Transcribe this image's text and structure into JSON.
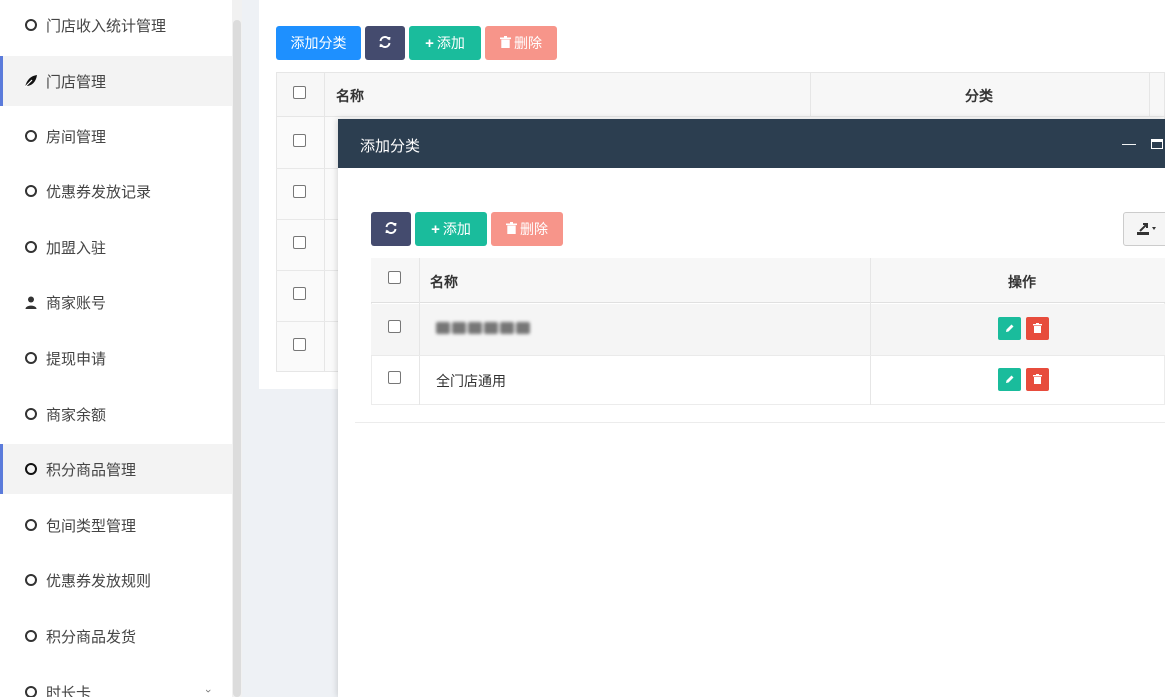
{
  "sidebar": {
    "items": [
      {
        "label": "门店收入统计管理",
        "icon": "circle-icon",
        "active": false
      },
      {
        "label": "门店管理",
        "icon": "leaf-icon",
        "active": true
      },
      {
        "label": "房间管理",
        "icon": "circle-icon",
        "active": false
      },
      {
        "label": "优惠券发放记录",
        "icon": "circle-icon",
        "active": false
      },
      {
        "label": "加盟入驻",
        "icon": "circle-icon",
        "active": false
      },
      {
        "label": "商家账号",
        "icon": "user-icon",
        "active": false
      },
      {
        "label": "提现申请",
        "icon": "circle-icon",
        "active": false
      },
      {
        "label": "商家余额",
        "icon": "circle-icon",
        "active": false
      },
      {
        "label": "积分商品管理",
        "icon": "circle-icon",
        "active": true
      },
      {
        "label": "包间类型管理",
        "icon": "circle-icon",
        "active": false
      },
      {
        "label": "优惠券发放规则",
        "icon": "circle-icon",
        "active": false
      },
      {
        "label": "积分商品发货",
        "icon": "circle-icon",
        "active": false
      },
      {
        "label": "时长卡",
        "icon": "circle-icon",
        "active": false
      }
    ]
  },
  "toolbar": {
    "add_category_label": "添加分类",
    "add_label": "添加",
    "delete_label": "删除"
  },
  "table": {
    "columns": [
      "名称",
      "分类"
    ]
  },
  "modal": {
    "title": "添加分类",
    "toolbar": {
      "add_label": "添加",
      "delete_label": "删除"
    },
    "columns": [
      "名称",
      "操作"
    ],
    "rows": [
      {
        "name": "",
        "obscured": true
      },
      {
        "name": "全门店通用",
        "obscured": false
      }
    ]
  },
  "colors": {
    "primary": "#1e90ff",
    "dark": "#444b6e",
    "success": "#1abc9c",
    "danger_light": "#f7958a",
    "danger": "#e74c3c",
    "modal_header": "#2c3e50",
    "active_border": "#5b7bdb"
  }
}
